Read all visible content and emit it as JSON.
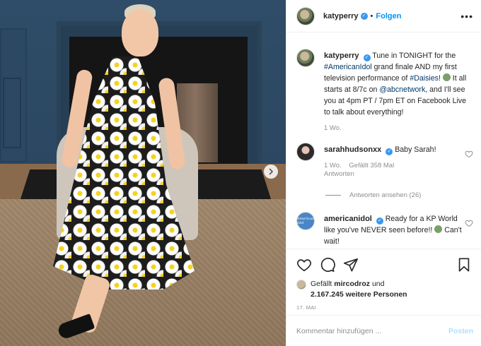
{
  "post": {
    "username": "katyperry",
    "follow_label": "Folgen",
    "more_label": "•••",
    "caption": {
      "part1": "Tune in TONIGHT for the ",
      "tag1": "#AmericanIdol",
      "part2": " grand finale AND my first television performance of ",
      "tag2": "#Daisies",
      "part3": "! ",
      "part4": " It all starts at 8/7c on ",
      "tag3": "@abcnetwork",
      "part5": ", and I'll see you at 4pm PT / 7pm ET on Facebook Live to talk about everything!"
    },
    "caption_time": "1 Wo."
  },
  "comments": [
    {
      "username": "sarahhudsonxx",
      "text": "Baby Sarah!",
      "time": "1 Wo.",
      "likes": "Gefällt 358 Mal",
      "reply_label": "Antworten",
      "view_replies": "Antworten ansehen (26)"
    },
    {
      "username": "americanidol",
      "text": "Ready for a KP World like you've NEVER seen before!! ",
      "tail": " Can't wait!",
      "avatar_text": "American Idol"
    }
  ],
  "actions": {
    "liked_by_prefix": "Gefällt ",
    "liked_by_user": "mircodroz",
    "liked_by_mid": " und",
    "liked_by_count": "2.167.245 weitere Personen",
    "date": "17. MAI"
  },
  "composer": {
    "placeholder": "Kommentar hinzufügen ...",
    "post_label": "Posten"
  },
  "colors": {
    "link_blue": "#0095f6",
    "tag_blue": "#00376b",
    "muted": "#8e8e8e",
    "post_disabled": "#b2dffc",
    "verified": "#3897f0"
  }
}
